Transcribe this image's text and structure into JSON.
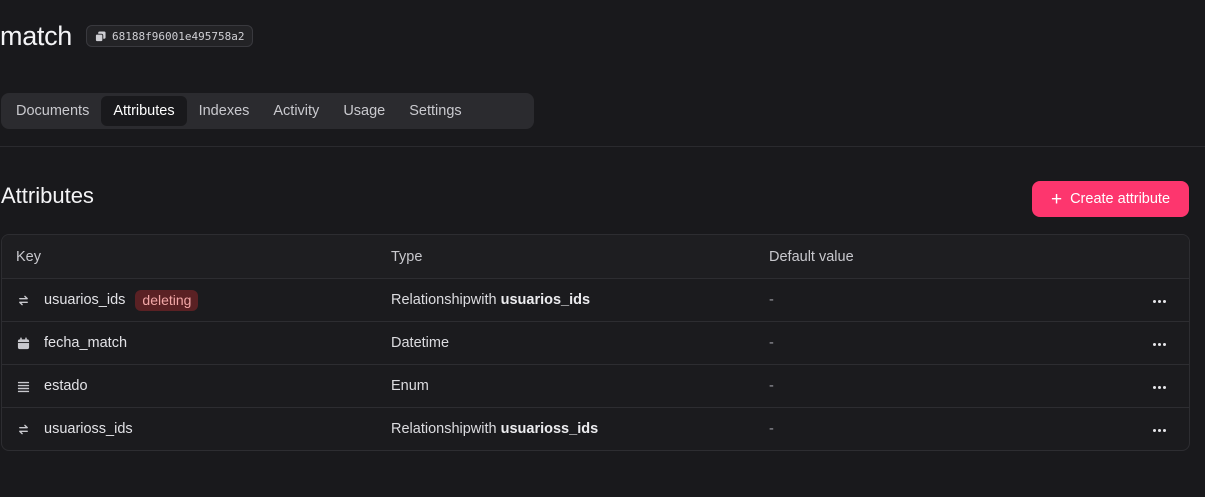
{
  "collection": {
    "title": "match",
    "id": "68188f96001e495758a2"
  },
  "tabs": [
    {
      "label": "Documents",
      "active": false
    },
    {
      "label": "Attributes",
      "active": true
    },
    {
      "label": "Indexes",
      "active": false
    },
    {
      "label": "Activity",
      "active": false
    },
    {
      "label": "Usage",
      "active": false
    },
    {
      "label": "Settings",
      "active": false
    }
  ],
  "section": {
    "title": "Attributes",
    "create_label": "Create attribute"
  },
  "table": {
    "headers": {
      "key": "Key",
      "type": "Type",
      "default": "Default value"
    },
    "rows": [
      {
        "icon": "relationship-icon",
        "key": "usuarios_ids",
        "badge": "deleting",
        "type_prefix": "Relationshipwith ",
        "type_bold": "usuarios_ids",
        "default": "-"
      },
      {
        "icon": "calendar-icon",
        "key": "fecha_match",
        "badge": "",
        "type_prefix": "Datetime",
        "type_bold": "",
        "default": "-"
      },
      {
        "icon": "list-icon",
        "key": "estado",
        "badge": "",
        "type_prefix": "Enum",
        "type_bold": "",
        "default": "-"
      },
      {
        "icon": "relationship-icon",
        "key": "usuarioss_ids",
        "badge": "",
        "type_prefix": "Relationshipwith ",
        "type_bold": "usuarioss_ids",
        "default": "-"
      }
    ]
  },
  "colors": {
    "accent": "#fd366e",
    "background": "#19191c",
    "badge_bg": "#5a2124",
    "badge_text": "#f2a7a7"
  }
}
